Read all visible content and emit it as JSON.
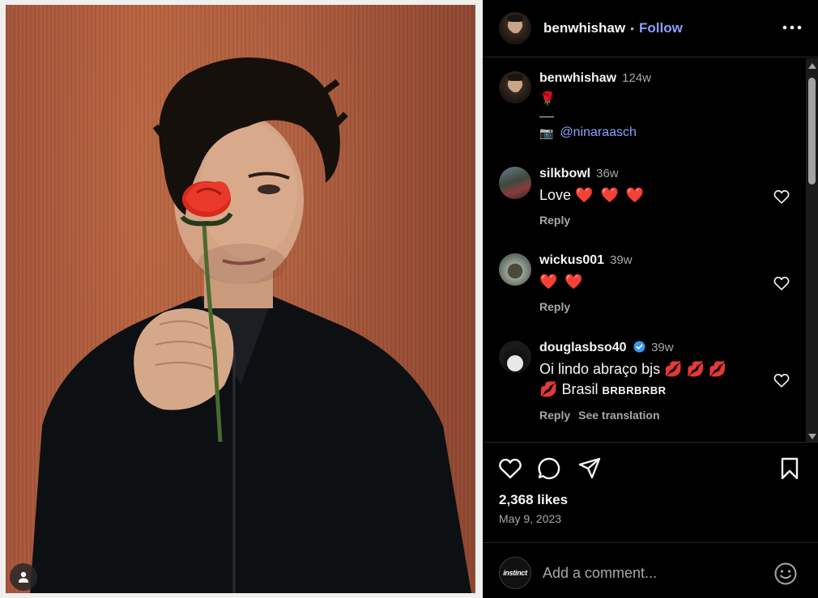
{
  "post": {
    "author": "benwhishaw",
    "follow_label": "Follow",
    "dot": "•",
    "caption": {
      "username": "benwhishaw",
      "age": "124w",
      "emoji": "🌹",
      "rule": "—",
      "camera_icon": "📷",
      "mention": "@ninaraasch"
    },
    "likes": "2,368 likes",
    "date": "May 9, 2023"
  },
  "comments": [
    {
      "username": "silkbowl",
      "age": "36w",
      "text": "Love",
      "emoji": "❤️ ❤️ ❤️",
      "reply_label": "Reply"
    },
    {
      "username": "wickus001",
      "age": "39w",
      "emoji": "❤️ ❤️",
      "reply_label": "Reply"
    },
    {
      "username": "douglasbso40",
      "age": "39w",
      "verified": true,
      "text_part1": "Oi lindo abraço bjs",
      "kisses_a": "💋 💋 💋",
      "kisses_b": "💋",
      "text_part2": "Brasil",
      "text_part3": "BRBRBRBR",
      "reply_label": "Reply",
      "translate_label": "See translation"
    }
  ],
  "composer": {
    "avatar_text": "instinct",
    "placeholder": "Add a comment..."
  },
  "colors": {
    "background": "#000000",
    "link_blue": "#8aa0ff",
    "secondary_text": "#a8a8a8",
    "divider": "#262626",
    "verified_blue": "#3797f0"
  },
  "icons": {
    "header": [
      "more-options-icon"
    ],
    "actions": [
      "heart-icon",
      "comment-icon",
      "share-icon",
      "bookmark-icon"
    ],
    "other": [
      "user-tag-icon",
      "emoji-icon",
      "camera-icon",
      "verified-badge-icon"
    ]
  }
}
